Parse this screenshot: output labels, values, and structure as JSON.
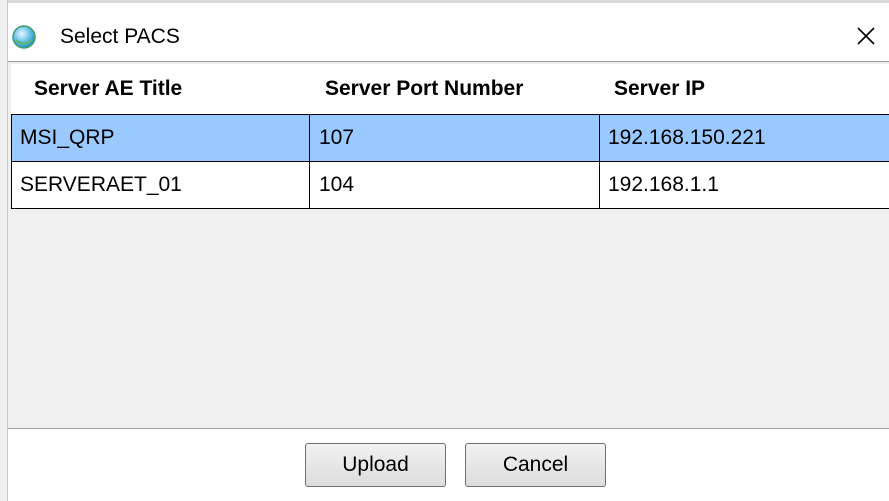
{
  "window": {
    "title": "Select PACS",
    "icon": "app-orb-icon",
    "close_icon": "close-icon"
  },
  "table": {
    "columns": [
      "Server AE Title",
      "Server Port Number",
      "Server IP"
    ],
    "rows": [
      {
        "ae_title": "MSI_QRP",
        "port": "107",
        "ip": "192.168.150.221",
        "selected": true
      },
      {
        "ae_title": "SERVERAET_01",
        "port": "104",
        "ip": "192.168.1.1",
        "selected": false
      }
    ],
    "selected_color": "#99c9ff"
  },
  "buttons": {
    "upload_label": "Upload",
    "cancel_label": "Cancel"
  }
}
